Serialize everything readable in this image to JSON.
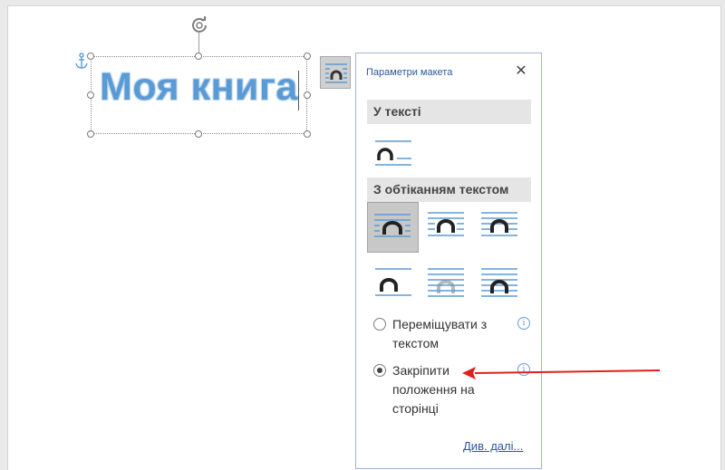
{
  "document": {
    "wordart_text": "Моя книга",
    "wordart_color": "#5b9bd5",
    "icons": [
      "rotate-handle-icon",
      "anchor-icon",
      "layout-options-icon"
    ]
  },
  "layout_panel": {
    "title": "Параметри макета",
    "close_label": "✕",
    "in_line_section": "У тексті",
    "wrap_section": "З обтіканням текстом",
    "wrap_options": [
      {
        "name": "square",
        "selected": true
      },
      {
        "name": "tight",
        "selected": false
      },
      {
        "name": "through",
        "selected": false
      },
      {
        "name": "top-and-bottom",
        "selected": false
      },
      {
        "name": "behind-text",
        "selected": false
      },
      {
        "name": "in-front-of-text",
        "selected": false
      }
    ],
    "radio_move": {
      "label": "Переміщувати з текстом",
      "checked": false
    },
    "radio_fix": {
      "label": "Закріпити положення на сторінці",
      "checked": true
    },
    "info_icon": "i",
    "more_link": "Див. далі...",
    "accent_color": "#2b579a"
  },
  "annotation": {
    "arrow_color": "#e02020"
  }
}
